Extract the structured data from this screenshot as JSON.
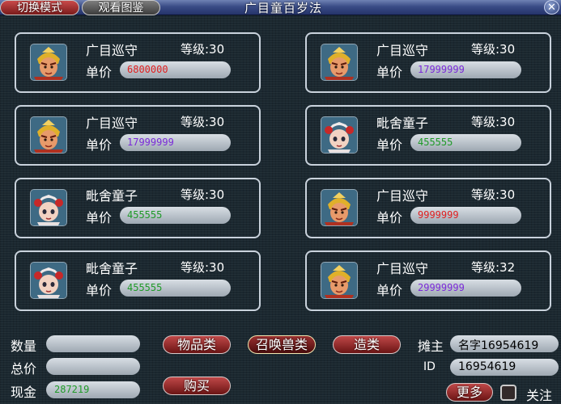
{
  "window": {
    "title": "广目童百岁法",
    "tab_switch": "切换模式",
    "tab_view": "观看图鉴",
    "close_glyph": "✕"
  },
  "colors": {
    "price_red": "#e02020",
    "price_purple": "#7a2ad8",
    "price_green": "#1f9a28"
  },
  "items": [
    {
      "name": "广目巡守",
      "level": "等级:30",
      "price_label": "单价",
      "price": "6800000",
      "price_color": "price_red",
      "icon": "guardian-portrait-icon"
    },
    {
      "name": "广目巡守",
      "level": "等级:30",
      "price_label": "单价",
      "price": "17999999",
      "price_color": "price_purple",
      "icon": "guardian-portrait-icon"
    },
    {
      "name": "广目巡守",
      "level": "等级:30",
      "price_label": "单价",
      "price": "17999999",
      "price_color": "price_purple",
      "icon": "guardian-portrait-icon"
    },
    {
      "name": "毗舍童子",
      "level": "等级:30",
      "price_label": "单价",
      "price": "455555",
      "price_color": "price_green",
      "icon": "child-portrait-icon"
    },
    {
      "name": "毗舍童子",
      "level": "等级:30",
      "price_label": "单价",
      "price": "455555",
      "price_color": "price_green",
      "icon": "child-portrait-icon"
    },
    {
      "name": "广目巡守",
      "level": "等级:30",
      "price_label": "单价",
      "price": "9999999",
      "price_color": "price_red",
      "icon": "guardian-portrait-icon"
    },
    {
      "name": "毗舍童子",
      "level": "等级:30",
      "price_label": "单价",
      "price": "455555",
      "price_color": "price_green",
      "icon": "child-portrait-icon"
    },
    {
      "name": "广目巡守",
      "level": "等级:32",
      "price_label": "单价",
      "price": "29999999",
      "price_color": "price_purple",
      "icon": "guardian-portrait-icon"
    }
  ],
  "footer": {
    "quantity_label": "数量",
    "quantity_value": "",
    "total_label": "总价",
    "total_value": "",
    "cash_label": "现金",
    "cash_value": "287219",
    "category_items": "物品类",
    "category_pets": "召唤兽类",
    "category_craft": "造类",
    "buy_button": "购买",
    "owner_label": "摊主",
    "owner_name": "名字16954619",
    "id_label": "ID",
    "id_value": "16954619",
    "more_button": "更多",
    "follow_label": "关注"
  }
}
